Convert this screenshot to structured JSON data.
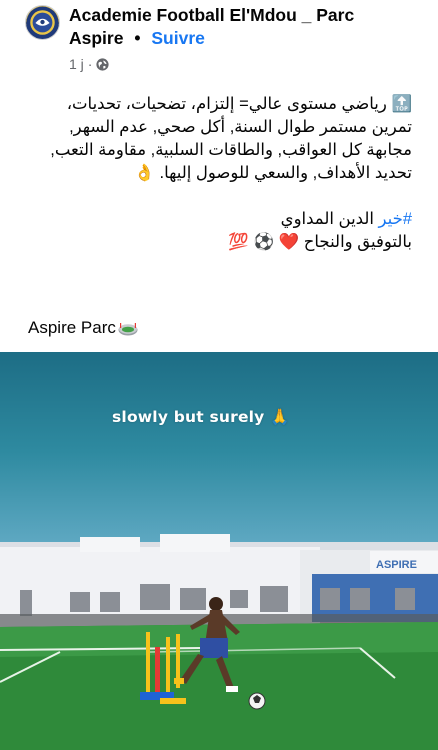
{
  "header": {
    "page_name_part1": "Academie Football El'Mdou _ Parc",
    "page_name_part2": "Aspire",
    "separator": "•",
    "follow_label": "Suivre",
    "time": "1 j",
    "meta_dot": "·",
    "privacy_icon": "globe-icon"
  },
  "post": {
    "line1": "🔝 رياضي مستوى عالي= إلتزام، تضحيات، تحديات،",
    "line2": "تمرين مستمر طوال السنة, أكل صحي, عدم السهر,",
    "line3": "مجابهة كل العواقب, والطاقات السلبية, مقاومة التعب,",
    "line4": "تحديد الأهداف, والسعي للوصول إليها. 👌",
    "hashtag": "#خير",
    "hashtag_rest": " الدين المداوي",
    "line6": "بالتوفيق والنجاح ❤️ ⚽ 💯",
    "place": "Aspire Parc",
    "place_icon": "stadium-icon"
  },
  "media": {
    "caption": "slowly but surely 🙏",
    "sign_text": "ASPIRE"
  },
  "colors": {
    "link": "#1877f2",
    "meta": "#65676b",
    "text": "#050505"
  }
}
